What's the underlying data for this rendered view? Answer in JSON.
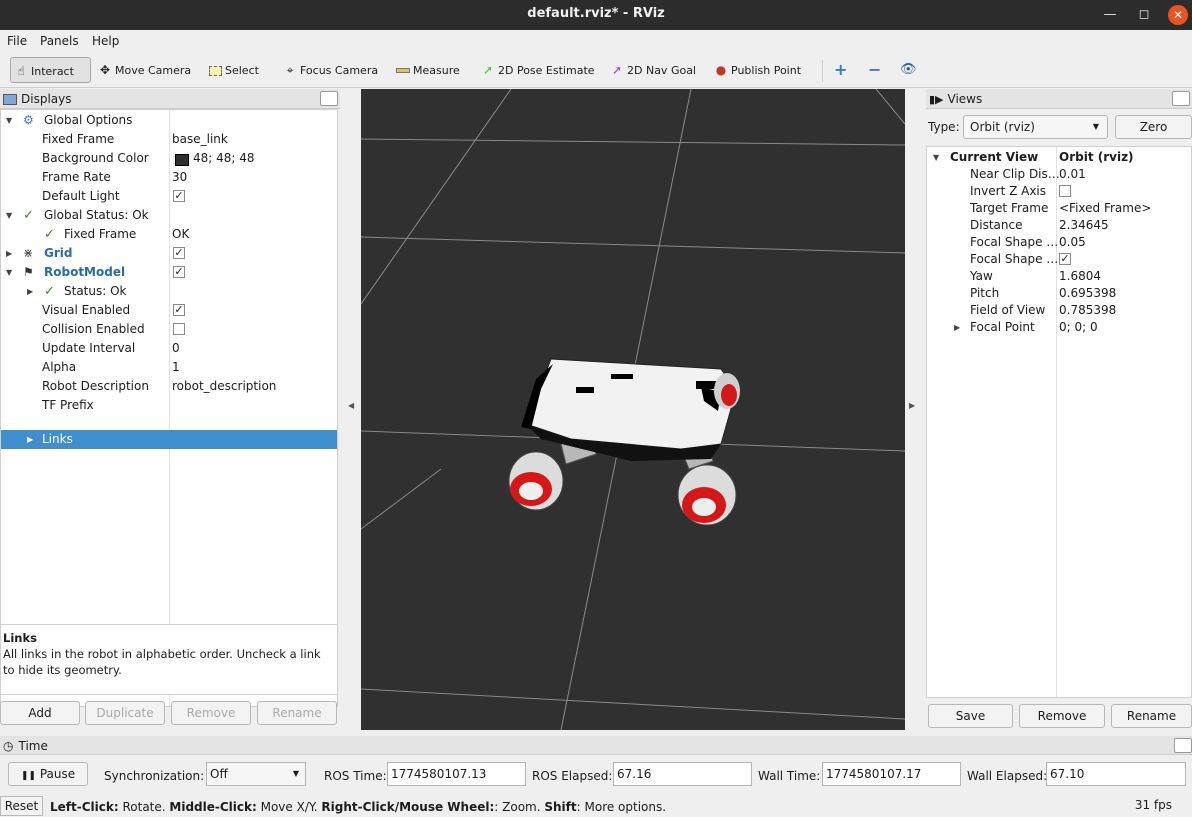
{
  "window": {
    "title": "default.rviz* - RViz"
  },
  "menu": [
    "File",
    "Panels",
    "Help"
  ],
  "toolbar": {
    "interact": "Interact",
    "move_camera": "Move Camera",
    "select": "Select",
    "focus_camera": "Focus Camera",
    "measure": "Measure",
    "pose_estimate": "2D Pose Estimate",
    "nav_goal": "2D Nav Goal",
    "publish_point": "Publish Point"
  },
  "displays": {
    "title": "Displays",
    "global_options": "Global Options",
    "fixed_frame": {
      "label": "Fixed Frame",
      "value": "base_link"
    },
    "background_color": {
      "label": "Background Color",
      "value": "48; 48; 48",
      "swatch": "#303030"
    },
    "frame_rate": {
      "label": "Frame Rate",
      "value": "30"
    },
    "default_light": {
      "label": "Default Light",
      "checked": true
    },
    "global_status": "Global Status: Ok",
    "fixed_frame_status": {
      "label": "Fixed Frame",
      "value": "OK"
    },
    "grid": {
      "label": "Grid",
      "checked": true
    },
    "robot_model": {
      "label": "RobotModel",
      "checked": true
    },
    "status_ok": "Status: Ok",
    "visual_enabled": {
      "label": "Visual Enabled",
      "checked": true
    },
    "collision_enabled": {
      "label": "Collision Enabled",
      "checked": false
    },
    "update_interval": {
      "label": "Update Interval",
      "value": "0"
    },
    "alpha": {
      "label": "Alpha",
      "value": "1"
    },
    "robot_description": {
      "label": "Robot Description",
      "value": "robot_description"
    },
    "tf_prefix": {
      "label": "TF Prefix",
      "value": ""
    },
    "links": {
      "label": "Links"
    },
    "description": {
      "title": "Links",
      "text": "All links in the robot in alphabetic order. Uncheck a link to hide its geometry."
    },
    "buttons": {
      "add": "Add",
      "duplicate": "Duplicate",
      "remove": "Remove",
      "rename": "Rename"
    }
  },
  "views": {
    "title": "Views",
    "type_label": "Type:",
    "type_value": "Orbit (rviz)",
    "zero": "Zero",
    "current_view": {
      "label": "Current View",
      "value": "Orbit (rviz)"
    },
    "props": [
      {
        "label": "Near Clip Dis…",
        "value": "0.01"
      },
      {
        "label": "Invert Z Axis",
        "value": "",
        "checkbox": true,
        "checked": false
      },
      {
        "label": "Target Frame",
        "value": "<Fixed Frame>"
      },
      {
        "label": "Distance",
        "value": "2.34645"
      },
      {
        "label": "Focal Shape …",
        "value": "0.05"
      },
      {
        "label": "Focal Shape …",
        "value": "",
        "checkbox": true,
        "checked": true
      },
      {
        "label": "Yaw",
        "value": "1.6804"
      },
      {
        "label": "Pitch",
        "value": "0.695398"
      },
      {
        "label": "Field of View",
        "value": "0.785398"
      },
      {
        "label": "Focal Point",
        "value": "0; 0; 0"
      }
    ],
    "buttons": {
      "save": "Save",
      "remove": "Remove",
      "rename": "Rename"
    }
  },
  "time": {
    "title": "Time",
    "pause": "Pause",
    "sync_label": "Synchronization:",
    "sync_value": "Off",
    "ros_time_label": "ROS Time:",
    "ros_time": "1774580107.13",
    "ros_elapsed_label": "ROS Elapsed:",
    "ros_elapsed": "67.16",
    "wall_time_label": "Wall Time:",
    "wall_time": "1774580107.17",
    "wall_elapsed_label": "Wall Elapsed:",
    "wall_elapsed": "67.10"
  },
  "status": {
    "reset": "Reset",
    "left_click": "Left-Click:",
    "left_click_desc": " Rotate. ",
    "middle_click": "Middle-Click:",
    "middle_click_desc": " Move X/Y. ",
    "right_click": "Right-Click/Mouse Wheel:",
    "right_click_desc": ": Zoom. ",
    "shift": "Shift",
    "shift_desc": ": More options.",
    "fps": "31 fps"
  }
}
